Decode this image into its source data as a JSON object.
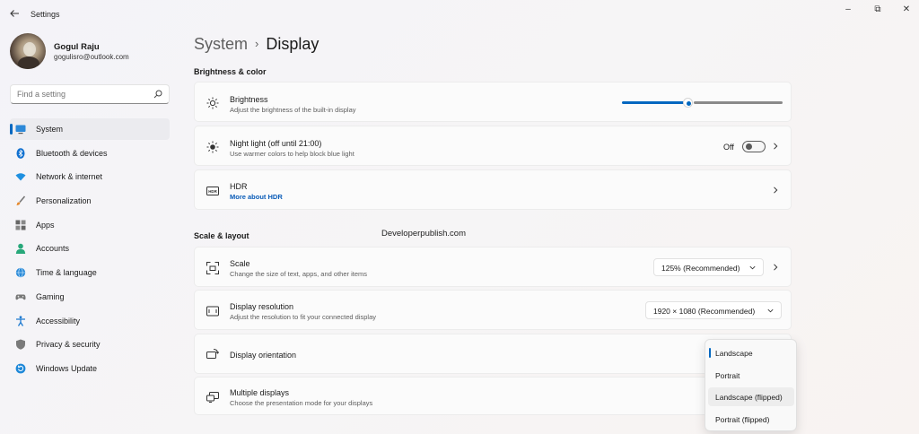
{
  "window": {
    "app_title": "Settings",
    "back_icon": "back-arrow-icon",
    "minimize_glyph": "–",
    "maximize_glyph": "⧉",
    "close_glyph": "✕"
  },
  "profile": {
    "name": "Gogul Raju",
    "email": "gogulisro@outlook.com"
  },
  "search": {
    "placeholder": "Find a setting"
  },
  "sidebar": {
    "items": [
      {
        "label": "System",
        "icon": "system-icon",
        "active": true
      },
      {
        "label": "Bluetooth & devices",
        "icon": "bluetooth-icon"
      },
      {
        "label": "Network & internet",
        "icon": "wifi-icon"
      },
      {
        "label": "Personalization",
        "icon": "brush-icon"
      },
      {
        "label": "Apps",
        "icon": "apps-icon"
      },
      {
        "label": "Accounts",
        "icon": "accounts-icon"
      },
      {
        "label": "Time & language",
        "icon": "globe-icon"
      },
      {
        "label": "Gaming",
        "icon": "gamepad-icon"
      },
      {
        "label": "Accessibility",
        "icon": "accessibility-icon"
      },
      {
        "label": "Privacy & security",
        "icon": "shield-icon"
      },
      {
        "label": "Windows Update",
        "icon": "update-icon"
      }
    ]
  },
  "breadcrumb": {
    "parent": "System",
    "separator": "›",
    "current": "Display"
  },
  "sections": {
    "brightness_color": "Brightness & color",
    "scale_layout": "Scale & layout"
  },
  "watermark": "Developerpublish.com",
  "brightness": {
    "title": "Brightness",
    "desc": "Adjust the brightness of the built-in display",
    "level_percent": 43
  },
  "night_light": {
    "title": "Night light (off until 21:00)",
    "desc": "Use warmer colors to help block blue light",
    "toggle_label": "Off"
  },
  "hdr": {
    "title": "HDR",
    "link": "More about HDR"
  },
  "scale": {
    "title": "Scale",
    "desc": "Change the size of text, apps, and other items",
    "value": "125% (Recommended)"
  },
  "resolution": {
    "title": "Display resolution",
    "desc": "Adjust the resolution to fit your connected display",
    "value": "1920 × 1080 (Recommended)"
  },
  "orientation": {
    "title": "Display orientation",
    "options": [
      "Landscape",
      "Portrait",
      "Landscape (flipped)",
      "Portrait (flipped)"
    ],
    "selected": "Landscape",
    "hovered": "Landscape (flipped)"
  },
  "multiple_displays": {
    "title": "Multiple displays",
    "desc": "Choose the presentation mode for your displays"
  },
  "colors": {
    "accent": "#0067c0",
    "link": "#0a5cb8"
  }
}
